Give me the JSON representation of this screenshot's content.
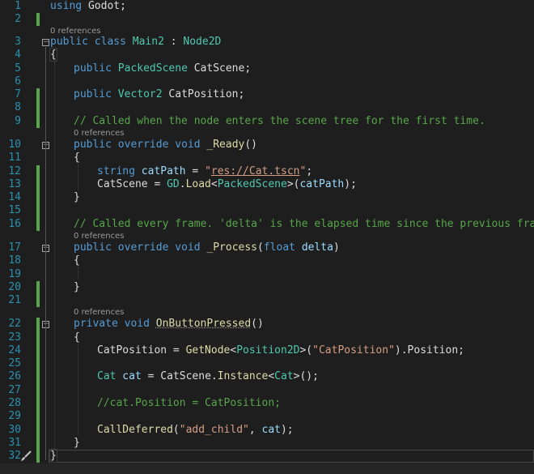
{
  "editor": {
    "line_numbers": [
      "1",
      "2",
      "3",
      "4",
      "5",
      "6",
      "7",
      "8",
      "9",
      "10",
      "11",
      "12",
      "13",
      "14",
      "15",
      "16",
      "17",
      "18",
      "19",
      "20",
      "21",
      "22",
      "23",
      "24",
      "25",
      "26",
      "27",
      "28",
      "29",
      "30",
      "31",
      "32"
    ],
    "codelens": "0 references",
    "tokens": {
      "l1_using": "using",
      "l1_rest": " Godot;",
      "l3_public": "public",
      "l3_class": "class",
      "l3_main2": "Main2",
      "l3_colon": " : ",
      "l3_node2d": "Node2D",
      "l4_brace": "{",
      "l5_public": "public",
      "l5_type": "PackedScene",
      "l5_name": " CatScene;",
      "l7_public": "public",
      "l7_type": "Vector2",
      "l7_name": " CatPosition;",
      "l9_comment": "// Called when the node enters the scene tree for the first time.",
      "l10_public": "public",
      "l10_override": "override",
      "l10_void": "void",
      "l10_method": "_Ready",
      "l10_parens": "()",
      "l11_brace": "{",
      "l12_string": "string",
      "l12_var": "catPath",
      "l12_eq": " = ",
      "l12_quote_open": "\"",
      "l12_path": "res://Cat.tscn",
      "l12_quote_close": "\"",
      "l12_semi": ";",
      "l13_catscene": "CatScene = ",
      "l13_gd": "GD",
      "l13_dot": ".",
      "l13_load": "Load",
      "l13_lt": "<",
      "l13_type": "PackedScene",
      "l13_gt": ">(",
      "l13_arg": "catPath",
      "l13_end": ");",
      "l14_brace": "}",
      "l16_comment": "// Called every frame. 'delta' is the elapsed time since the previous frame.",
      "l17_public": "public",
      "l17_override": "override",
      "l17_void": "void",
      "l17_method": "_Process",
      "l17_paren_open": "(",
      "l17_float": "float",
      "l17_param": "delta",
      "l17_paren_close": ")",
      "l18_brace": "{",
      "l20_brace": "}",
      "l22_private": "private",
      "l22_void": "void",
      "l22_method": "OnButtonPressed",
      "l22_parens": "()",
      "l23_brace": "{",
      "l24_start": "CatPosition = ",
      "l24_getnode": "GetNode",
      "l24_lt": "<",
      "l24_type": "Position2D",
      "l24_gt": ">(",
      "l24_str": "\"CatPosition\"",
      "l24_end": ").Position;",
      "l26_type": "Cat",
      "l26_var": " cat",
      "l26_eq": " = CatScene.",
      "l26_instance": "Instance",
      "l26_lt": "<",
      "l26_type2": "Cat",
      "l26_end": ">();",
      "l28_comment": "//cat.Position = CatPosition;",
      "l30_call": "CallDeferred",
      "l30_open": "(",
      "l30_str": "\"add_child\"",
      "l30_comma": ", ",
      "l30_arg": "cat",
      "l30_end": ");",
      "l31_brace": "}",
      "l32_brace": "}"
    },
    "icon": "paintbrush-icon",
    "colors": {
      "background": "#1e1e1e",
      "keyword": "#569cd6",
      "type": "#4ec9b0",
      "string": "#d69d85",
      "comment": "#57a64a",
      "method": "#dcdcaa",
      "variable": "#9cdcfe",
      "line_number": "#2b91af",
      "change_bar": "#57a64a"
    }
  }
}
